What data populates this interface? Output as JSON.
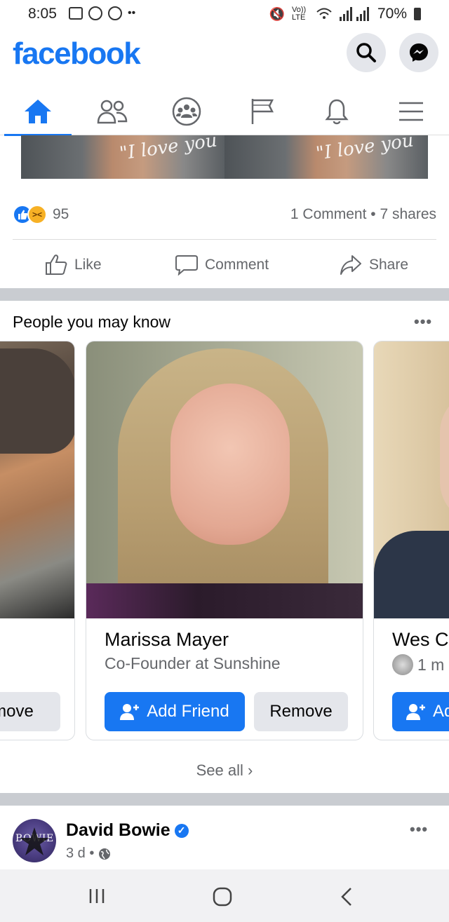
{
  "status_bar": {
    "time": "8:05",
    "network": "Vo)) LTE",
    "battery": "70%"
  },
  "header": {
    "logo": "facebook"
  },
  "post": {
    "image_caption": "\"I love you",
    "reaction_count": "95",
    "comments_shares": "1 Comment • 7 shares",
    "actions": {
      "like": "Like",
      "comment": "Comment",
      "share": "Share"
    }
  },
  "pymk": {
    "title": "People you may know",
    "cards": [
      {
        "name": "",
        "subtitle": "",
        "remove_label": "move"
      },
      {
        "name": "Marissa Mayer",
        "subtitle": "Co-Founder at Sunshine",
        "add_label": "Add Friend",
        "remove_label": "Remove"
      },
      {
        "name": "Wes C",
        "subtitle": "1 m",
        "add_label": "Ad"
      }
    ],
    "see_all": "See all"
  },
  "next_post": {
    "author": "David Bowie",
    "meta": "3 d •",
    "avatar_text": "BOWIE"
  },
  "colors": {
    "brand": "#1877f2",
    "separator": "#c9ccd1",
    "secondary_text": "#65676b"
  }
}
